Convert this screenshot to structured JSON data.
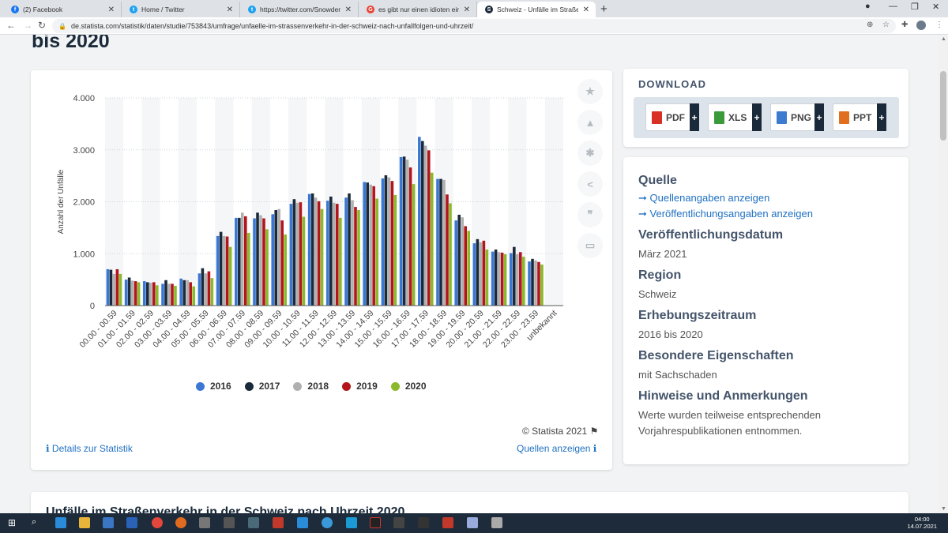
{
  "browser": {
    "tabs": [
      {
        "title": "(2) Facebook",
        "favicon": "facebook-icon",
        "color": "#1877f2"
      },
      {
        "title": "Home / Twitter",
        "favicon": "twitter-icon",
        "color": "#1da1f2"
      },
      {
        "title": "https://twitter.com/Snowden/sta",
        "favicon": "twitter-icon",
        "color": "#1da1f2"
      },
      {
        "title": "es gibt nur einen idioten einstür",
        "favicon": "google-icon",
        "color": "#ea4335"
      },
      {
        "title": "Schweiz - Unfälle im Straßenverk",
        "favicon": "statista-icon",
        "color": "#1b2a3a"
      }
    ],
    "url": "de.statista.com/statistik/daten/studie/753843/umfrage/unfaelle-im-strassenverkehr-in-der-schweiz-nach-unfallfolgen-und-uhrzeit/"
  },
  "page": {
    "heading_fragment": "bis 2020",
    "copyright": "© Statista 2021",
    "details_link": "Details zur Statistik",
    "sources_link": "Quellen anzeigen",
    "bottom_title": "Unfälle im Straßenverkehr in der Schweiz nach Uhrzeit 2020"
  },
  "download": {
    "title": "DOWNLOAD",
    "buttons": [
      {
        "label": "PDF",
        "color": "#d93025"
      },
      {
        "label": "XLS",
        "color": "#3a9b3a"
      },
      {
        "label": "PNG",
        "color": "#3b7bd0"
      },
      {
        "label": "PPT",
        "color": "#e07020"
      }
    ]
  },
  "info": {
    "quelle_title": "Quelle",
    "quelle_links": [
      "➞ Quellenangaben anzeigen",
      "➞ Veröffentlichungsangaben anzeigen"
    ],
    "pub_date_title": "Veröffentlichungsdatum",
    "pub_date": "März 2021",
    "region_title": "Region",
    "region": "Schweiz",
    "period_title": "Erhebungszeitraum",
    "period": "2016 bis 2020",
    "props_title": "Besondere Eigenschaften",
    "props": "mit Sachschaden",
    "notes_title": "Hinweise und Anmerkungen",
    "notes": "Werte wurden teilweise entsprechenden Vorjahrespublikationen entnommen."
  },
  "taskbar": {
    "time": "04:00",
    "date": "14.07.2021"
  },
  "chart_data": {
    "type": "bar",
    "ylabel": "Anzahl der Unfälle",
    "ylim": [
      0,
      4000
    ],
    "yticks": [
      0,
      1000,
      2000,
      3000,
      4000
    ],
    "ytick_labels": [
      "0",
      "1.000",
      "2.000",
      "3.000",
      "4.000"
    ],
    "grid": true,
    "legend_position": "bottom",
    "categories": [
      "00.00 - 00.59",
      "01.00 - 01.59",
      "02.00 - 02.59",
      "03.00 - 03.59",
      "04.00 - 04.59",
      "05.00 - 05.59",
      "06.00 - 06.59",
      "07.00 - 07.59",
      "08.00 - 08.59",
      "09.00 - 09.59",
      "10.00 - 10.59",
      "11.00 - 11.59",
      "12.00 - 12.59",
      "13.00 - 13.59",
      "14.00 - 14.59",
      "15.00 - 15.59",
      "16.00 - 16.59",
      "17.00 - 17.59",
      "18.00 - 18.59",
      "19.00 - 19.59",
      "20.00 - 20.59",
      "21.00 - 21.59",
      "22.00 - 22.59",
      "23.00 - 23.59",
      "unbekannt"
    ],
    "series": [
      {
        "name": "2016",
        "color": "#3a78d4",
        "values": [
          700,
          500,
          470,
          420,
          520,
          620,
          1340,
          1690,
          1680,
          1760,
          1960,
          2150,
          2020,
          2080,
          2380,
          2450,
          2860,
          3250,
          2440,
          1640,
          1200,
          1040,
          1010,
          850,
          0
        ]
      },
      {
        "name": "2017",
        "color": "#1b2a3a",
        "values": [
          690,
          540,
          450,
          490,
          490,
          720,
          1420,
          1690,
          1790,
          1840,
          2050,
          2160,
          2100,
          2160,
          2370,
          2510,
          2870,
          3170,
          2440,
          1750,
          1280,
          1080,
          1130,
          900,
          0
        ]
      },
      {
        "name": "2018",
        "color": "#b0b0b0",
        "values": [
          610,
          480,
          440,
          420,
          490,
          620,
          1340,
          1790,
          1740,
          1860,
          1980,
          2080,
          1980,
          2030,
          2330,
          2470,
          2810,
          3080,
          2420,
          1700,
          1220,
          1030,
          990,
          870,
          0
        ]
      },
      {
        "name": "2019",
        "color": "#b2151b",
        "values": [
          700,
          470,
          450,
          420,
          450,
          660,
          1330,
          1720,
          1680,
          1640,
          1990,
          2010,
          1960,
          1900,
          2300,
          2400,
          2660,
          2990,
          2140,
          1530,
          1250,
          1020,
          1030,
          840,
          0
        ]
      },
      {
        "name": "2020",
        "color": "#8cb82b",
        "values": [
          610,
          450,
          390,
          380,
          370,
          530,
          1130,
          1400,
          1470,
          1370,
          1710,
          1860,
          1690,
          1840,
          2060,
          2130,
          2340,
          2560,
          1970,
          1440,
          1080,
          990,
          940,
          790,
          0
        ]
      }
    ]
  }
}
